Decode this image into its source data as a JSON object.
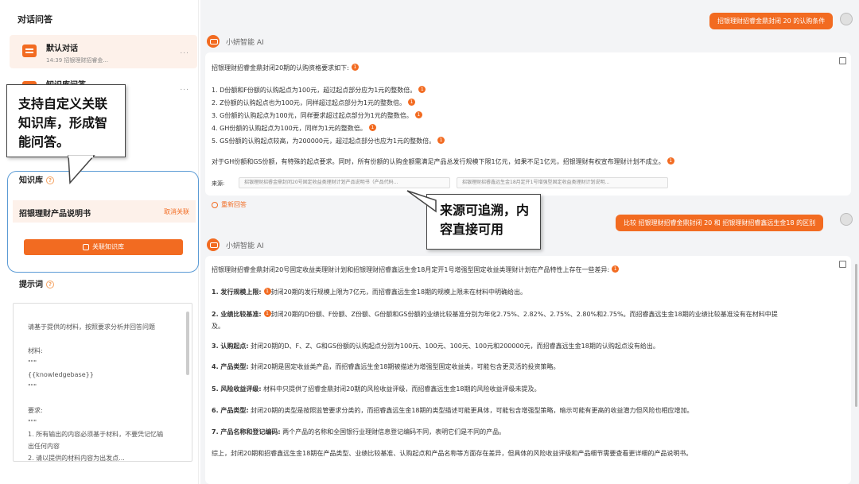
{
  "left": {
    "title": "对话问答",
    "conversations": [
      {
        "title": "默认对话",
        "subtitle": "14:39 招银理财招睿金...",
        "more": "..."
      },
      {
        "title": "知识库问答",
        "subtitle": "",
        "more": "..."
      }
    ],
    "kb_label": "知识库",
    "kb_help": "?",
    "kb_name": "招银理财产品说明书",
    "kb_unlink": "取消关联",
    "kb_button": "关联知识库",
    "prompt_label": "提示词",
    "prompt_help": "?",
    "prompt_lines": [
      "请基于提供的材料，按照要求分析并回答问题",
      "",
      "材料:",
      "\"\"\"",
      "{{knowledgebase}}",
      "\"\"\"",
      "",
      "要求:",
      "\"\"\"",
      "1. 所有输出的内容必须基于材料，不要凭记忆输",
      "出任何内容",
      "2. 请以提供的材料内容为出发点..."
    ]
  },
  "callouts": {
    "kb": "支持自定义关联知识库，形成智能问答。",
    "source": "来源可追溯，内容直接可用"
  },
  "chat": {
    "user_msg_1": "招银理财招睿金鼎封闭 20 的认购条件",
    "bot_name": "小妍智能 AI",
    "answer1": {
      "intro": "招银理财招睿金鼎封闭20期的认购资格要求如下:",
      "items": [
        "1. D份额和F份额的认购起点为100元，超过起点部分应为1元的整数倍。",
        "2. Z份额的认购起点也为100元，同样超过起点部分为1元的整数倍。",
        "3. G份额的认购起点为100元，同样要求超过起点部分为1元的整数倍。",
        "4. GH份额的认购起点为100元，同样为1元的整数倍。",
        "5. GS份额的认购起点较高，为200000元，超过起点部分也应为1元的整数倍。"
      ],
      "summary": "对于GH份额和GS份额，有特殊的起点要求。同时，所有份额的认购金额需满足产品总发行规模下限1亿元，如果不足1亿元，招银理财有权宣布理财计划不成立。",
      "source_label": "来源:",
      "sources": [
        "招银理财招睿金鼎封闭20号固定收益类理财计划产品说明书（产品代码...",
        "招银理财招睿鑫远生金18月定开1号增强型固定收益类理财计划说明..."
      ]
    },
    "regenerate": "重新回答",
    "user_msg_2": "比较 招银理财招睿金鼎封闭 20 和 招银理财招睿鑫远生金18 的区别",
    "answer2": {
      "intro": "招银理财招睿金鼎封闭20号固定收益类理财计划和招银理财招睿鑫远生金18月定开1号增强型固定收益类理财计划在产品特性上存在一些差异:",
      "points": [
        {
          "head": "1. 发行规模上限:",
          "text": "封闭20期的发行规模上限为7亿元，而招睿鑫远生金18期的规模上限未在材料中明确给出。"
        },
        {
          "head": "2. 业绩比较基准:",
          "text": "封闭20期的D份额、F份额、Z份额、G份额和GS份额的业绩比较基准分别为年化2.75%、2.82%、2.75%、2.80%和2.75%。而招睿鑫远生金18期的业绩比较基准没有在材料中提",
          "cont": "及。"
        },
        {
          "head": "3. 认购起点:",
          "text": "封闭20期的D、F、Z、G和GS份额的认购起点分别为100元、100元、100元、100元和200000元，而招睿鑫远生金18期的认购起点没有给出。"
        },
        {
          "head": "4. 产品类型:",
          "text": "封闭20期是固定收益类产品，而招睿鑫远生金18期被描述为增强型固定收益类，可能包含更灵活的投资策略。"
        },
        {
          "head": "5. 风险收益评级:",
          "text": "材料中只提供了招睿金鼎封闭20期的风险收益评级，而招睿鑫远生金18期的风险收益评级未提及。"
        },
        {
          "head": "6. 产品类型:",
          "text": "封闭20期的类型是按照监管要求分类的，而招睿鑫远生金18期的类型描述可能更具体，可能包含增强型策略，暗示可能有更高的收益潜力但风险也相应增加。"
        },
        {
          "head": "7. 产品名称和登记编码:",
          "text": "两个产品的名称和全国银行业理财信息登记编码不同，表明它们是不同的产品。"
        }
      ],
      "summary": "综上，封闭20期和招睿鑫远生金18期在产品类型、业绩比较基准、认购起点和产品名称等方面存在差异，但具体的风险收益评级和产品细节需要查看更详细的产品说明书。"
    }
  }
}
